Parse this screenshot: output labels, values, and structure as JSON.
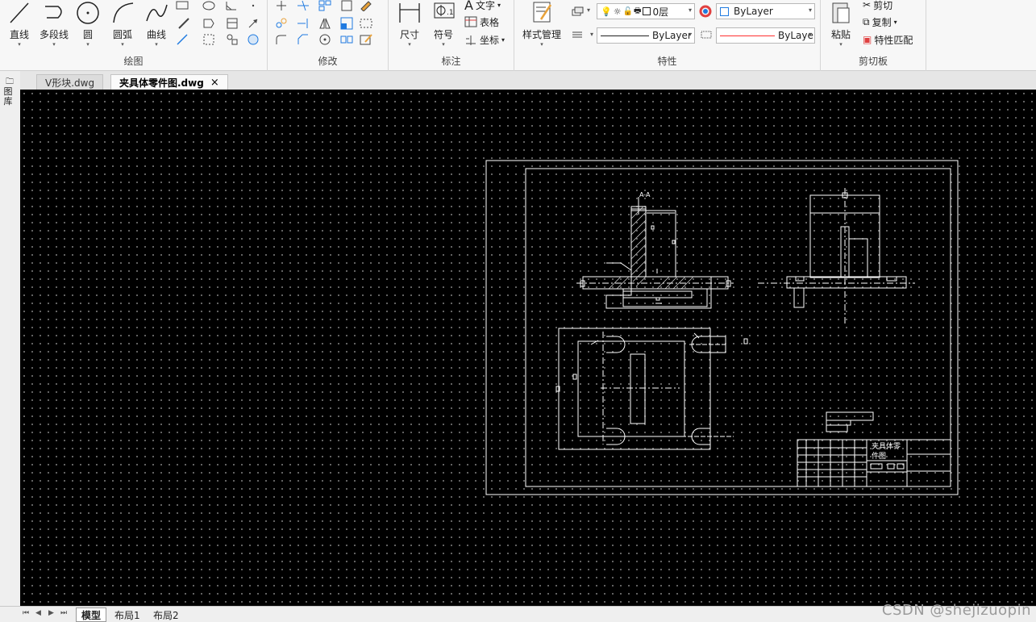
{
  "ribbon": {
    "draw": {
      "title": "绘图",
      "line": "直线",
      "polyline": "多段线",
      "circle": "圆",
      "arc": "圆弧",
      "curve": "曲线"
    },
    "modify": {
      "title": "修改"
    },
    "annotate": {
      "title": "标注",
      "dimension": "尺寸",
      "symbol": "符号",
      "text": "文字",
      "table": "表格",
      "coordinate": "坐标"
    },
    "properties": {
      "title": "特性",
      "style_manager": "样式管理",
      "layer_name": "0层",
      "color": "ByLayer",
      "linetype": "ByLayer",
      "lineweight": "ByLaye"
    },
    "clipboard": {
      "title": "剪切板",
      "paste": "粘贴",
      "cut": "剪切",
      "copy": "复制",
      "match": "特性匹配"
    }
  },
  "tabs": [
    {
      "label": "V形块.dwg"
    },
    {
      "label": "夹具体零件图.dwg"
    }
  ],
  "side_panel": {
    "label": "图库"
  },
  "layout_tabs": [
    "模型",
    "布局1",
    "布局2"
  ],
  "drawing": {
    "section_label": "A-A",
    "title_block_name_line1": "夹具体零",
    "title_block_name_line2": "件图"
  },
  "watermark": "CSDN @shejizuopin",
  "colors": {
    "canvas": "#000000",
    "grid_dot": "#7a7a7a",
    "line_color": "#ff3030",
    "color_box": "#1f7ae0"
  }
}
